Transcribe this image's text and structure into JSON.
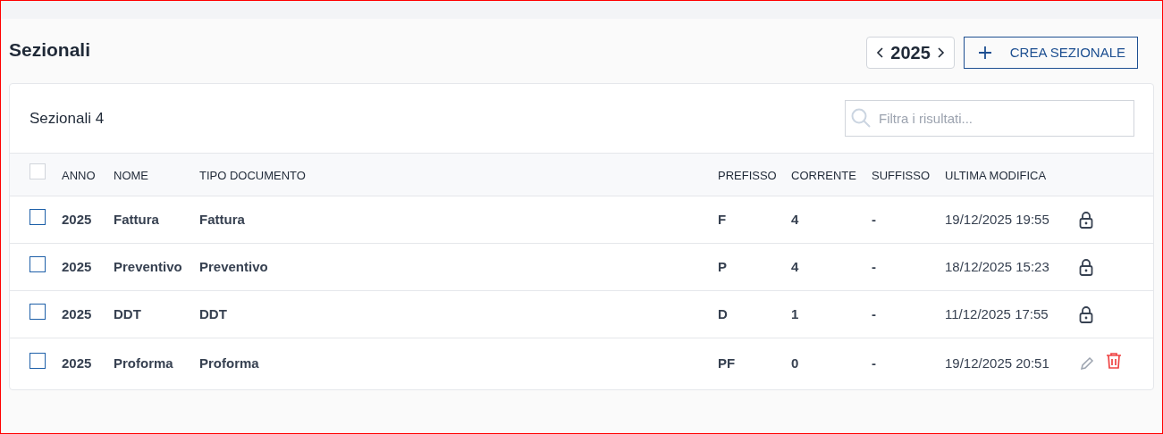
{
  "page": {
    "title": "Sezionali"
  },
  "year_picker": {
    "year": "2025"
  },
  "create_button": {
    "label": "CREA SEZIONALE"
  },
  "table_card": {
    "title": "Sezionali",
    "count": "4"
  },
  "search": {
    "placeholder": "Filtra i risultati..."
  },
  "table": {
    "select_all": {
      "checked": false
    },
    "columns": [
      "ANNO",
      "NOME",
      "TIPO DOCUMENTO",
      "PREFISSO",
      "CORRENTE",
      "SUFFISSO",
      "ULTIMA MODIFICA"
    ],
    "rows": [
      {
        "checked": false,
        "locked": true,
        "cells": [
          "2025",
          "Fattura",
          "Fattura",
          "F",
          "4",
          "-",
          "19/12/2025 19:55"
        ]
      },
      {
        "checked": false,
        "locked": true,
        "cells": [
          "2025",
          "Preventivo",
          "Preventivo",
          "P",
          "4",
          "-",
          "18/12/2025 15:23"
        ]
      },
      {
        "checked": false,
        "locked": true,
        "cells": [
          "2025",
          "DDT",
          "DDT",
          "D",
          "1",
          "-",
          "11/12/2025 17:55"
        ]
      },
      {
        "checked": false,
        "locked": false,
        "cells": [
          "2025",
          "Proforma",
          "Proforma",
          "PF",
          "0",
          "-",
          "19/12/2025 20:51"
        ]
      }
    ]
  }
}
